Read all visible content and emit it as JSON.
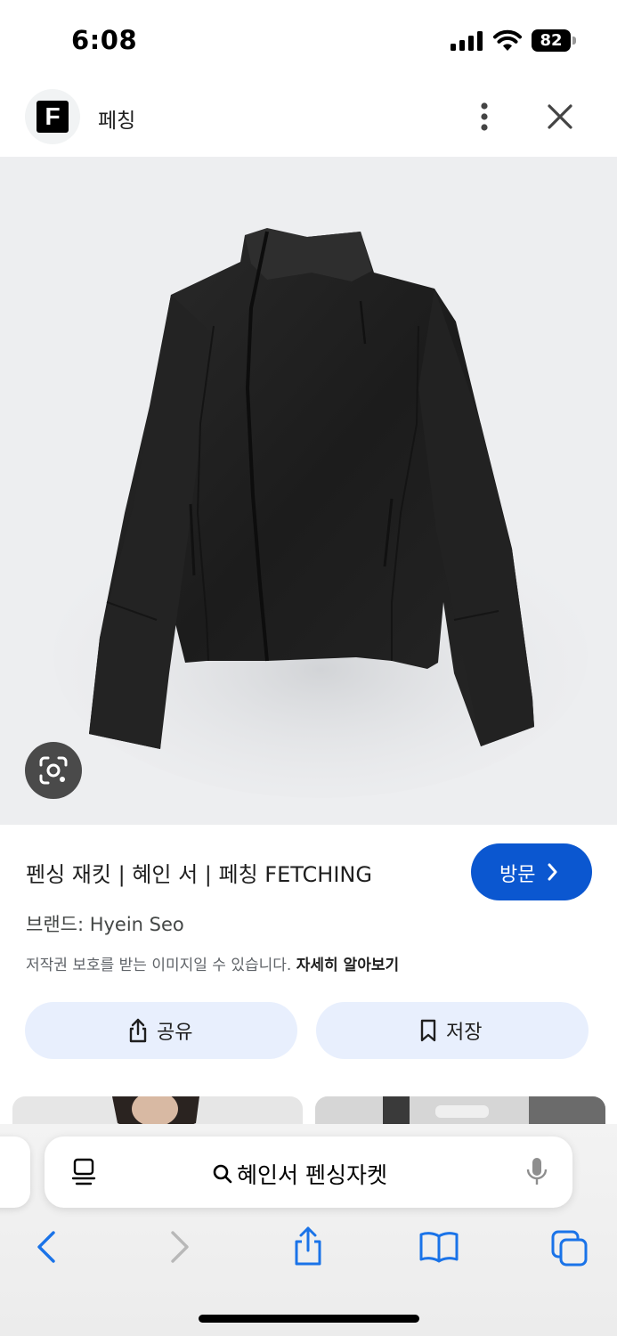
{
  "status_bar": {
    "time": "6:08",
    "battery": "82"
  },
  "header": {
    "site_logo": "F",
    "site_name": "페칭"
  },
  "result": {
    "title": "펜싱 재킷 | 혜인 서 | 페칭 FETCHING",
    "visit_label": "방문",
    "brand": "브랜드: Hyein Seo",
    "copyright_notice": "저작권 보호를 받는 이미지일 수 있습니다.",
    "learn_more": "자세히 알아보기",
    "share_label": "공유",
    "save_label": "저장"
  },
  "browser": {
    "url_text": "혜인서 펜싱자켓"
  },
  "colors": {
    "accent": "#0b57d0",
    "action_bg": "#e8effd",
    "image_bg": "#edeef0"
  },
  "icons": [
    "signal-icon",
    "wifi-icon",
    "battery-icon",
    "more-vert-icon",
    "close-icon",
    "lens-icon",
    "chevron-right-icon",
    "share-icon",
    "bookmark-icon",
    "reader-icon",
    "search-icon",
    "mic-icon",
    "back-icon",
    "forward-icon",
    "tabs-icon"
  ]
}
